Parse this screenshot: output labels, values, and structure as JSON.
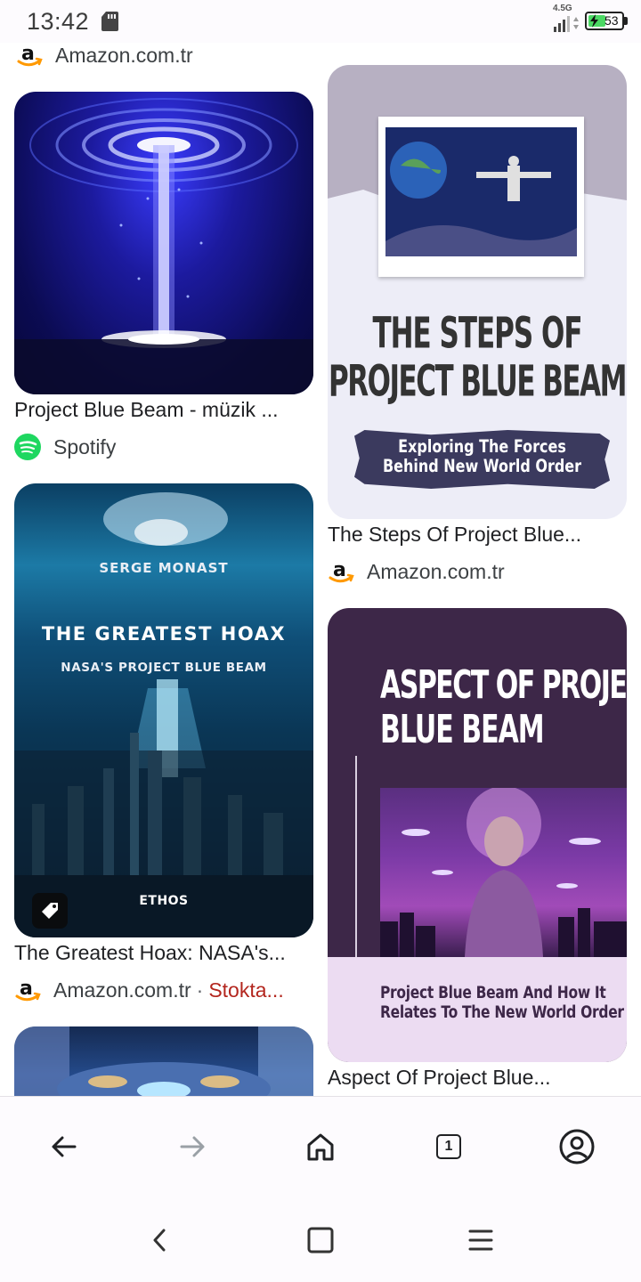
{
  "status_bar": {
    "time": "13:42",
    "network": "4.5G",
    "battery_level": "53",
    "battery_fraction": 0.53,
    "icons": [
      "sd-card-icon",
      "signal-icon",
      "battery-charging-icon"
    ]
  },
  "results": {
    "top_source": {
      "name": "Amazon.com.tr",
      "logo": "amazon-logo-icon"
    },
    "cards": [
      {
        "id": "blue-beam-music",
        "title": "Project Blue Beam - müzik ...",
        "source": "Spotify",
        "logo": "spotify-logo-icon"
      },
      {
        "id": "steps-of-project-blue-beam",
        "title": "The Steps Of Project Blue...",
        "source": "Amazon.com.tr",
        "logo": "amazon-logo-icon",
        "cover": {
          "title_line_1": "THE STEPS OF",
          "title_line_2": "PROJECT BLUE BEAM",
          "banner_line_1": "Exploring The Forces",
          "banner_line_2": "Behind New World Order"
        }
      },
      {
        "id": "greatest-hoax",
        "title": "The Greatest Hoax: NASA's...",
        "source": "Amazon.com.tr",
        "separator": "·",
        "stock": "Stokta...",
        "logo": "amazon-logo-icon",
        "badge": "price-tag-icon",
        "cover": {
          "author": "SERGE MONAST",
          "title": "THE GREATEST HOAX",
          "subtitle": "NASA'S PROJECT BLUE BEAM",
          "publisher": "ETHOS"
        }
      },
      {
        "id": "aspect-of-project-blue-beam",
        "title": "Aspect Of Project Blue...",
        "cover": {
          "title_line_1": "ASPECT OF PROJECT",
          "title_line_2": "BLUE BEAM",
          "footer_line_1": "Project Blue Beam And How It",
          "footer_line_2": "Relates To The New World Order"
        }
      }
    ]
  },
  "toolbar": {
    "back": "back-arrow-icon",
    "forward": "forward-arrow-icon",
    "home": "home-icon",
    "tab_count": "1",
    "account": "account-icon"
  },
  "system_nav": [
    "system-back-icon",
    "system-home-icon",
    "system-menu-icon"
  ],
  "colors": {
    "stock_text": "#b3261e",
    "spotify_green": "#1ed760",
    "amazon_orange": "#ff9900",
    "aspect_purple": "#3d2748",
    "steps_banner": "#3b3a5e"
  }
}
